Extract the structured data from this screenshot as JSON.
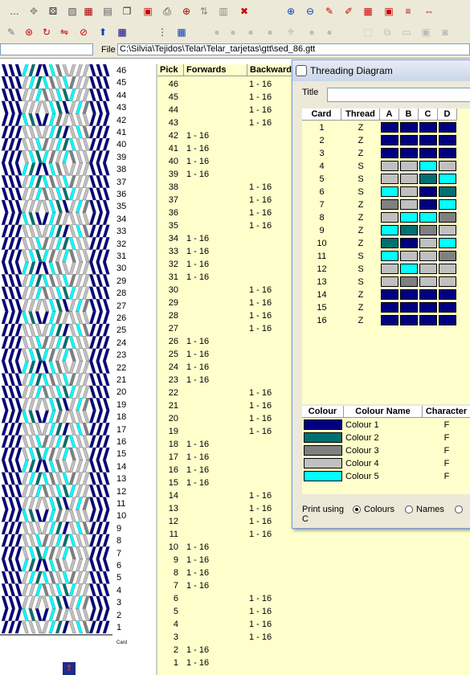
{
  "toolbar_row1": [
    {
      "name": "dotted-menu-icon",
      "glyph": "…",
      "color": "#222"
    },
    {
      "name": "move-icon",
      "glyph": "✥",
      "color": "#888"
    },
    {
      "name": "dice-icon",
      "glyph": "⚄",
      "color": "#222"
    },
    {
      "name": "diagonal-stripes-icon",
      "glyph": "▨",
      "color": "#555"
    },
    {
      "name": "grid-icon",
      "glyph": "▦",
      "color": "#a00"
    },
    {
      "name": "list-icon",
      "glyph": "▤",
      "color": "#555"
    },
    {
      "name": "copy-pages-icon",
      "glyph": "❐",
      "color": "#333"
    },
    {
      "name": "save-icon",
      "glyph": "▣",
      "color": "#c00"
    },
    {
      "name": "printer-icon",
      "glyph": "⎙",
      "color": "#333"
    },
    {
      "name": "zoom-plus-icon",
      "glyph": "⊕",
      "color": "#a00"
    },
    {
      "name": "cards-icon",
      "glyph": "⇅",
      "color": "#888"
    },
    {
      "name": "weave-icon",
      "glyph": "▥",
      "color": "#888"
    },
    {
      "name": "cross-icon",
      "glyph": "✖",
      "color": "#c00"
    },
    {
      "name": "zoom-in-icon",
      "glyph": "⊕",
      "color": "#0040c0"
    },
    {
      "name": "zoom-out-icon",
      "glyph": "⊖",
      "color": "#0040c0"
    },
    {
      "name": "tool-a-icon",
      "glyph": "✎",
      "color": "#c00"
    },
    {
      "name": "tool-b-icon",
      "glyph": "✐",
      "color": "#c00"
    },
    {
      "name": "tool-c-icon",
      "glyph": "▦",
      "color": "#c00"
    },
    {
      "name": "tool-d-icon",
      "glyph": "▣",
      "color": "#c00"
    },
    {
      "name": "tool-e-icon",
      "glyph": "≡",
      "color": "#c00"
    },
    {
      "name": "tool-f-icon",
      "glyph": "⇔",
      "color": "#c00"
    }
  ],
  "toolbar_row2": [
    {
      "name": "pencil-icon",
      "glyph": "✎",
      "color": "#777"
    },
    {
      "name": "lifebuoy-icon",
      "glyph": "⊛",
      "color": "#c00"
    },
    {
      "name": "rotate-icon",
      "glyph": "↻",
      "color": "#c00"
    },
    {
      "name": "flip-icon",
      "glyph": "⇋",
      "color": "#c00"
    },
    {
      "name": "no-icon",
      "glyph": "⊘",
      "color": "#c00"
    },
    {
      "name": "up-arrow-icon",
      "glyph": "⬆",
      "color": "#0040c0"
    },
    {
      "name": "table-icon",
      "glyph": "▦",
      "color": "#000080"
    },
    {
      "name": "dotted-grid-icon",
      "glyph": "⋮",
      "color": "#333"
    },
    {
      "name": "small-grid-icon",
      "glyph": "▦",
      "color": "#0040c0"
    },
    {
      "name": "circle-a-icon",
      "glyph": "●",
      "color": "#bbb"
    },
    {
      "name": "circle-b-icon",
      "glyph": "●",
      "color": "#bbb"
    },
    {
      "name": "circle-c-icon",
      "glyph": "●",
      "color": "#bbb"
    },
    {
      "name": "circle-d-icon",
      "glyph": "●",
      "color": "#bbb"
    },
    {
      "name": "fleur-icon",
      "glyph": "⚜",
      "color": "#bbb"
    },
    {
      "name": "circle-e-icon",
      "glyph": "●",
      "color": "#bbb"
    },
    {
      "name": "circle-f-icon",
      "glyph": "●",
      "color": "#bbb"
    },
    {
      "name": "frame-icon",
      "glyph": "⬚",
      "color": "#bbb"
    },
    {
      "name": "shapes-icon",
      "glyph": "⧉",
      "color": "#bbb"
    },
    {
      "name": "paste-icon",
      "glyph": "▭",
      "color": "#bbb"
    },
    {
      "name": "clipboard-icon",
      "glyph": "▣",
      "color": "#bbb"
    },
    {
      "name": "camera-icon",
      "glyph": "◙",
      "color": "#bbb"
    }
  ],
  "path_label": "File",
  "file_path": "C:\\Silvia\\Tejidos\\Telar\\Telar_tarjetas\\gtt\\sed_86.gtt",
  "pattern_pick_numbers": [
    "46",
    "45",
    "44",
    "43",
    "42",
    "41",
    "40",
    "39",
    "38",
    "37",
    "36",
    "35",
    "34",
    "33",
    "32",
    "31",
    "30",
    "29",
    "28",
    "27",
    "26",
    "25",
    "24",
    "23",
    "22",
    "21",
    "20",
    "19",
    "18",
    "17",
    "16",
    "15",
    "14",
    "13",
    "12",
    "11",
    "10",
    "9",
    "8",
    "7",
    "6",
    "5",
    "4",
    "3",
    "2",
    "1"
  ],
  "pattern_footer_label": "Card",
  "pick_sheet": {
    "headers": {
      "pick": "Pick",
      "forwards": "Forwards",
      "backwards": "Backwards"
    },
    "rows": [
      {
        "pick": "46",
        "forwards": "",
        "backwards": "1 - 16"
      },
      {
        "pick": "45",
        "forwards": "",
        "backwards": "1 - 16"
      },
      {
        "pick": "44",
        "forwards": "",
        "backwards": "1 - 16"
      },
      {
        "pick": "43",
        "forwards": "",
        "backwards": "1 - 16"
      },
      {
        "pick": "42",
        "forwards": "1 - 16",
        "backwards": ""
      },
      {
        "pick": "41",
        "forwards": "1 - 16",
        "backwards": ""
      },
      {
        "pick": "40",
        "forwards": "1 - 16",
        "backwards": ""
      },
      {
        "pick": "39",
        "forwards": "1 - 16",
        "backwards": ""
      },
      {
        "pick": "38",
        "forwards": "",
        "backwards": "1 - 16"
      },
      {
        "pick": "37",
        "forwards": "",
        "backwards": "1 - 16"
      },
      {
        "pick": "36",
        "forwards": "",
        "backwards": "1 - 16"
      },
      {
        "pick": "35",
        "forwards": "",
        "backwards": "1 - 16"
      },
      {
        "pick": "34",
        "forwards": "1 - 16",
        "backwards": ""
      },
      {
        "pick": "33",
        "forwards": "1 - 16",
        "backwards": ""
      },
      {
        "pick": "32",
        "forwards": "1 - 16",
        "backwards": ""
      },
      {
        "pick": "31",
        "forwards": "1 - 16",
        "backwards": ""
      },
      {
        "pick": "30",
        "forwards": "",
        "backwards": "1 - 16"
      },
      {
        "pick": "29",
        "forwards": "",
        "backwards": "1 - 16"
      },
      {
        "pick": "28",
        "forwards": "",
        "backwards": "1 - 16"
      },
      {
        "pick": "27",
        "forwards": "",
        "backwards": "1 - 16"
      },
      {
        "pick": "26",
        "forwards": "1 - 16",
        "backwards": ""
      },
      {
        "pick": "25",
        "forwards": "1 - 16",
        "backwards": ""
      },
      {
        "pick": "24",
        "forwards": "1 - 16",
        "backwards": ""
      },
      {
        "pick": "23",
        "forwards": "1 - 16",
        "backwards": ""
      },
      {
        "pick": "22",
        "forwards": "",
        "backwards": "1 - 16"
      },
      {
        "pick": "21",
        "forwards": "",
        "backwards": "1 - 16"
      },
      {
        "pick": "20",
        "forwards": "",
        "backwards": "1 - 16"
      },
      {
        "pick": "19",
        "forwards": "",
        "backwards": "1 - 16"
      },
      {
        "pick": "18",
        "forwards": "1 - 16",
        "backwards": ""
      },
      {
        "pick": "17",
        "forwards": "1 - 16",
        "backwards": ""
      },
      {
        "pick": "16",
        "forwards": "1 - 16",
        "backwards": ""
      },
      {
        "pick": "15",
        "forwards": "1 - 16",
        "backwards": ""
      },
      {
        "pick": "14",
        "forwards": "",
        "backwards": "1 - 16"
      },
      {
        "pick": "13",
        "forwards": "",
        "backwards": "1 - 16"
      },
      {
        "pick": "12",
        "forwards": "",
        "backwards": "1 - 16"
      },
      {
        "pick": "11",
        "forwards": "",
        "backwards": "1 - 16"
      },
      {
        "pick": "10",
        "forwards": "1 - 16",
        "backwards": ""
      },
      {
        "pick": "9",
        "forwards": "1 - 16",
        "backwards": ""
      },
      {
        "pick": "8",
        "forwards": "1 - 16",
        "backwards": ""
      },
      {
        "pick": "7",
        "forwards": "1 - 16",
        "backwards": ""
      },
      {
        "pick": "6",
        "forwards": "",
        "backwards": "1 - 16"
      },
      {
        "pick": "5",
        "forwards": "",
        "backwards": "1 - 16"
      },
      {
        "pick": "4",
        "forwards": "",
        "backwards": "1 - 16"
      },
      {
        "pick": "3",
        "forwards": "",
        "backwards": "1 - 16"
      },
      {
        "pick": "2",
        "forwards": "1 - 16",
        "backwards": ""
      },
      {
        "pick": "1",
        "forwards": "1 - 16",
        "backwards": ""
      }
    ]
  },
  "threading_dialog": {
    "title": "Threading Diagram",
    "title_label": "Title",
    "title_value": "",
    "card_headers": {
      "card": "Card",
      "thread": "Thread",
      "holes": [
        "A",
        "B",
        "C",
        "D"
      ]
    },
    "cards": [
      {
        "card": "1",
        "thread": "Z",
        "holes": [
          1,
          1,
          1,
          1
        ]
      },
      {
        "card": "2",
        "thread": "Z",
        "holes": [
          1,
          1,
          1,
          1
        ]
      },
      {
        "card": "3",
        "thread": "Z",
        "holes": [
          1,
          1,
          1,
          1
        ]
      },
      {
        "card": "4",
        "thread": "S",
        "holes": [
          4,
          4,
          5,
          4
        ]
      },
      {
        "card": "5",
        "thread": "S",
        "holes": [
          4,
          4,
          2,
          5
        ]
      },
      {
        "card": "6",
        "thread": "S",
        "holes": [
          5,
          4,
          1,
          2
        ]
      },
      {
        "card": "7",
        "thread": "Z",
        "holes": [
          3,
          4,
          1,
          5
        ]
      },
      {
        "card": "8",
        "thread": "Z",
        "holes": [
          4,
          5,
          5,
          3
        ]
      },
      {
        "card": "9",
        "thread": "Z",
        "holes": [
          5,
          2,
          3,
          4
        ]
      },
      {
        "card": "10",
        "thread": "Z",
        "holes": [
          2,
          1,
          4,
          5
        ]
      },
      {
        "card": "11",
        "thread": "S",
        "holes": [
          5,
          4,
          4,
          3
        ]
      },
      {
        "card": "12",
        "thread": "S",
        "holes": [
          4,
          5,
          4,
          4
        ]
      },
      {
        "card": "13",
        "thread": "S",
        "holes": [
          4,
          3,
          4,
          4
        ]
      },
      {
        "card": "14",
        "thread": "Z",
        "holes": [
          1,
          1,
          1,
          1
        ]
      },
      {
        "card": "15",
        "thread": "Z",
        "holes": [
          1,
          1,
          1,
          1
        ]
      },
      {
        "card": "16",
        "thread": "Z",
        "holes": [
          1,
          1,
          1,
          1
        ]
      }
    ],
    "colour_headers": {
      "colour": "Colour",
      "name": "Colour Name",
      "character": "Character"
    },
    "colours": [
      {
        "hex": "#000080",
        "name": "Colour 1",
        "character": "F"
      },
      {
        "hex": "#007070",
        "name": "Colour 2",
        "character": "F"
      },
      {
        "hex": "#808080",
        "name": "Colour 3",
        "character": "F"
      },
      {
        "hex": "#c0c0c0",
        "name": "Colour 4",
        "character": "F"
      },
      {
        "hex": "#00ffff",
        "name": "Colour 5",
        "character": "F"
      }
    ],
    "print_using_label": "Print using",
    "print_options": [
      {
        "label": "Colours",
        "selected": true
      },
      {
        "label": "Names",
        "selected": false
      },
      {
        "label": "C",
        "selected": false
      }
    ]
  }
}
